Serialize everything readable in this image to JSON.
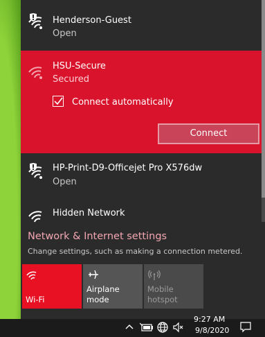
{
  "networks": [
    {
      "name": "Henderson-Guest",
      "status": "Open",
      "secured": false,
      "shield": true
    },
    {
      "name": "HSU-Secure",
      "status": "Secured",
      "secured": true,
      "shield": false
    },
    {
      "name": "HP-Print-D9-Officejet Pro X576dw",
      "status": "Open",
      "secured": false,
      "shield": true
    },
    {
      "name": "Hidden Network",
      "status": "",
      "secured": false,
      "shield": false
    }
  ],
  "selected_network": {
    "checkbox_label": "Connect automatically",
    "checkbox_checked": true,
    "connect_label": "Connect"
  },
  "settings": {
    "title": "Network & Internet settings",
    "subtitle": "Change settings, such as making a connection metered."
  },
  "quick_actions": [
    {
      "label": "Wi-Fi",
      "active": true,
      "icon": "wifi-icon"
    },
    {
      "label": "Airplane mode",
      "active": false,
      "icon": "airplane-icon"
    },
    {
      "label_line1": "Mobile",
      "label_line2": "hotspot",
      "active": false,
      "disabled": true,
      "icon": "hotspot-icon"
    }
  ],
  "taskbar": {
    "time": "9:27 AM",
    "date": "9/8/2020"
  },
  "colors": {
    "accent": "#d9132b",
    "flyout_bg": "#2b2b2b",
    "settings_link": "#f3a6b0"
  }
}
